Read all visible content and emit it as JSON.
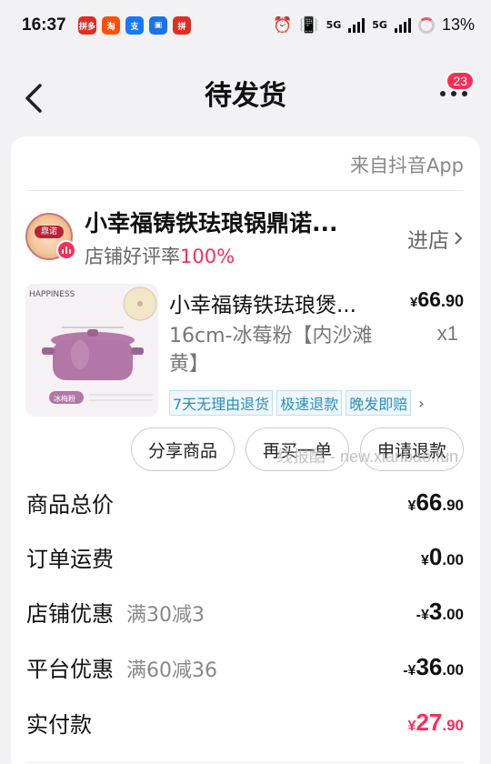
{
  "status_bar": {
    "time": "16:37",
    "apps": [
      {
        "label": "拼多",
        "color": "#e02e24"
      },
      {
        "label": "淘",
        "color": "#ff5000"
      },
      {
        "label": "支",
        "color": "#1677ff"
      },
      {
        "label": "▣",
        "color": "#1a73e8"
      },
      {
        "label": "拼",
        "color": "#e02e24"
      }
    ],
    "signal_1": "5G",
    "signal_2": "5G",
    "battery": "13%"
  },
  "header": {
    "title": "待发货",
    "badge_count": "23"
  },
  "order": {
    "source": "来自抖音App",
    "shop": {
      "name": "小幸福铸铁珐琅锅鼎诺...",
      "rating_label": "店铺好评率",
      "rating_value": "100%",
      "enter_label": "进店",
      "logo_text": "鼎诺"
    },
    "product": {
      "title": "小幸福铸铁珐琅煲...",
      "price_int": "66",
      "price_dec": ".90",
      "currency": "¥",
      "spec": "16cm-冰莓粉【内沙滩黄】",
      "qty": "x1",
      "brand_text": "HAPPINESS",
      "color_label": "冰梅粉",
      "tags": [
        "7天无理由退货",
        "极速退款",
        "晚发即赔"
      ]
    },
    "buttons": {
      "share": "分享商品",
      "rebuy": "再买一单",
      "refund": "申请退款"
    },
    "watermark": "线报酷 - new.xianbao.fun",
    "summary": [
      {
        "label": "商品总价",
        "note": "",
        "prefix": "¥",
        "int": "66",
        "dec": ".90",
        "highlight": false
      },
      {
        "label": "订单运费",
        "note": "",
        "prefix": "¥",
        "int": "0",
        "dec": ".00",
        "highlight": false
      },
      {
        "label": "店铺优惠",
        "note": "满30减3",
        "prefix": "-¥",
        "int": "3",
        "dec": ".00",
        "highlight": false
      },
      {
        "label": "平台优惠",
        "note": "满60减36",
        "prefix": "-¥",
        "int": "36",
        "dec": ".00",
        "highlight": false
      },
      {
        "label": "实付款",
        "note": "",
        "prefix": "¥",
        "int": "27",
        "dec": ".90",
        "highlight": true
      }
    ]
  }
}
